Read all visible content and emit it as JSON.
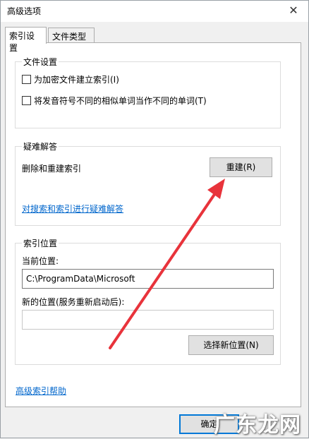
{
  "window": {
    "title": "高级选项",
    "close_glyph": "✕"
  },
  "tabs": [
    {
      "label": "索引设置",
      "active": true
    },
    {
      "label": "文件类型",
      "active": false
    }
  ],
  "file_settings": {
    "title": "文件设置",
    "options": [
      {
        "label": "为加密文件建立索引(I)",
        "checked": false
      },
      {
        "label": "将发音符号不同的相似单词当作不同的单词(T)",
        "checked": false
      }
    ]
  },
  "troubleshooting": {
    "title": "疑难解答",
    "rebuild_text": "删除和重建索引",
    "rebuild_button": "重建(R)",
    "trouble_link": "对搜索和索引进行疑难解答"
  },
  "index_location": {
    "title": "索引位置",
    "current_label": "当前位置:",
    "current_value": "C:\\ProgramData\\Microsoft",
    "new_label": "新的位置(服务重新启动后):",
    "new_value": "",
    "choose_button": "选择新位置(N)"
  },
  "help_link": "高级索引帮助",
  "ok_button": "确定",
  "watermark": "广东龙网",
  "colors": {
    "link": "#0066cc",
    "arrow": "#e8333b",
    "focus": "#0078d7"
  }
}
